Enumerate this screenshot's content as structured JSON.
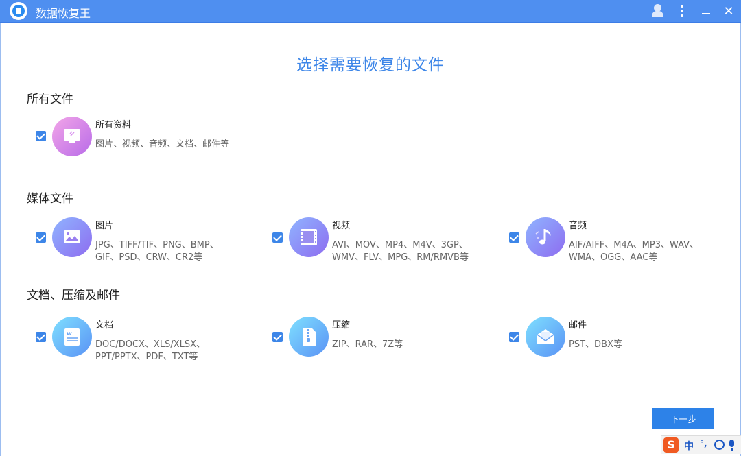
{
  "app": {
    "title": "数据恢复王"
  },
  "titlebar": {
    "icons": [
      "user-icon",
      "menu-icon",
      "minimize-icon",
      "close-icon"
    ],
    "close_glyph": "✕"
  },
  "page": {
    "title": "选择需要恢复的文件"
  },
  "sections": [
    {
      "title": "所有文件"
    },
    {
      "title": "媒体文件"
    },
    {
      "title": "文档、压缩及邮件"
    }
  ],
  "items": {
    "all": {
      "name": "所有资料",
      "desc": "图片、视频、音频、文档、邮件等",
      "checked": true,
      "icon": "monitor-icon"
    },
    "picture": {
      "name": "图片",
      "desc": "JPG、TIFF/TIF、PNG、BMP、GIF、PSD、CRW、CR2等",
      "checked": true,
      "icon": "picture-icon"
    },
    "video": {
      "name": "视频",
      "desc": "AVI、MOV、MP4、M4V、3GP、WMV、FLV、MPG、RM/RMVB等",
      "checked": true,
      "icon": "film-icon"
    },
    "audio": {
      "name": "音频",
      "desc": "AIF/AIFF、M4A、MP3、WAV、WMA、OGG、AAC等",
      "checked": true,
      "icon": "music-note-icon"
    },
    "document": {
      "name": "文档",
      "desc": "DOC/DOCX、XLS/XLSX、PPT/PPTX、PDF、TXT等",
      "checked": true,
      "icon": "document-icon"
    },
    "archive": {
      "name": "压缩",
      "desc": "ZIP、RAR、7Z等",
      "checked": true,
      "icon": "zip-icon"
    },
    "mail": {
      "name": "邮件",
      "desc": "PST、DBX等",
      "checked": true,
      "icon": "mail-icon"
    }
  },
  "buttons": {
    "next": "下一步"
  },
  "ime": {
    "logo": "S",
    "lang": "中",
    "punct": "°,"
  },
  "colors": {
    "titlebar": "#4f8ff0",
    "accent": "#3d86e8",
    "title_text": "#3d86e8"
  }
}
